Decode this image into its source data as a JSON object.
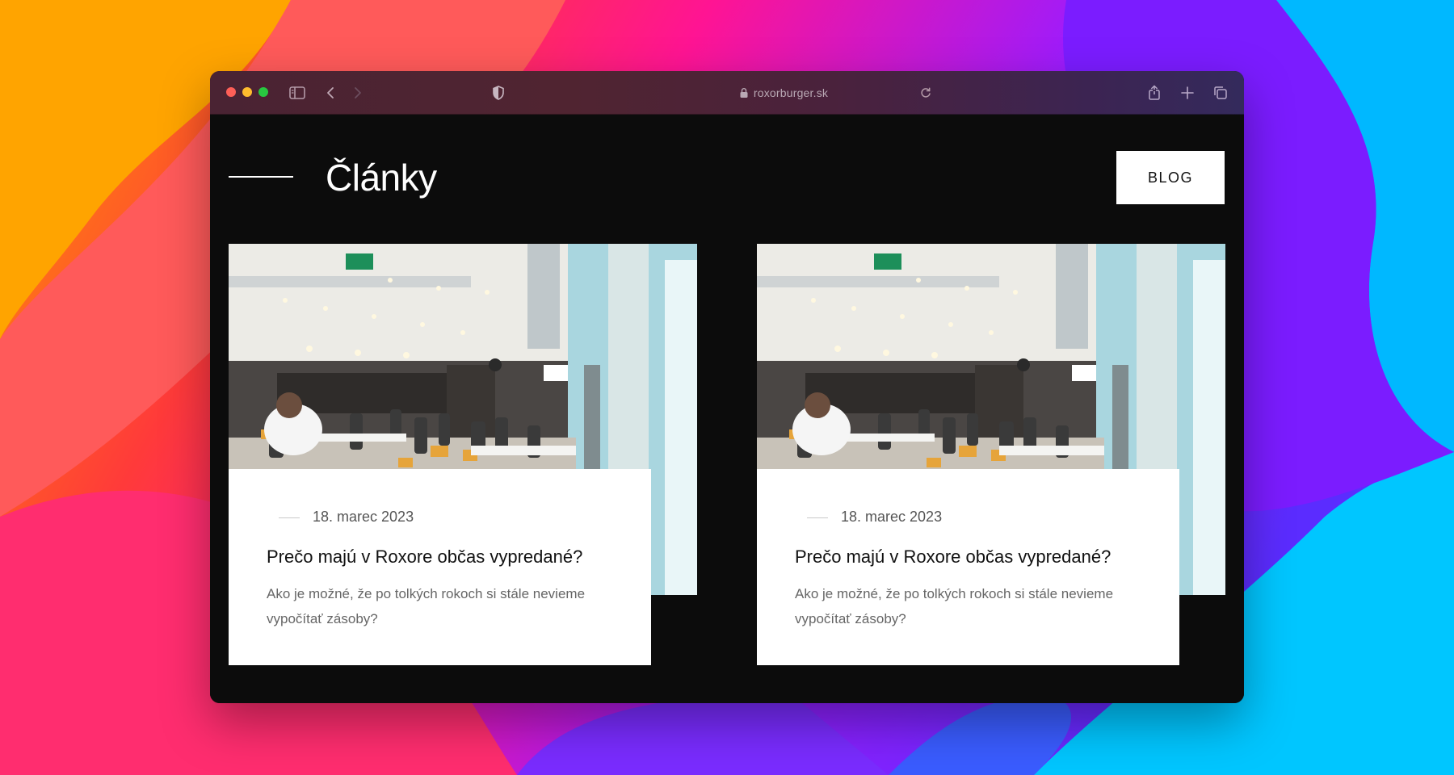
{
  "browser": {
    "url": "roxorburger.sk"
  },
  "page": {
    "title": "Články",
    "blog_button": "BLOG"
  },
  "articles": [
    {
      "date": "18. marec 2023",
      "title": "Prečo majú v Roxore občas vypredané?",
      "excerpt": "Ako je možné, že po tolkých rokoch si stále nevieme vypočítať zásoby?"
    },
    {
      "date": "18. marec 2023",
      "title": "Prečo majú v Roxore občas vypredané?",
      "excerpt": "Ako je možné, že po tolkých rokoch si stále nevieme vypočítať zásoby?"
    }
  ],
  "icons": {
    "sidebar": "sidebar-icon",
    "back": "chevron-left-icon",
    "forward": "chevron-right-icon",
    "privacy": "shield-icon",
    "lock": "lock-icon",
    "reload": "reload-icon",
    "share": "share-icon",
    "new_tab": "plus-icon",
    "tabs": "tabs-overview-icon"
  },
  "colors": {
    "page_background": "#0c0c0c",
    "card_background": "#ffffff",
    "button_background": "#ffffff",
    "traffic_red": "#fe5f57",
    "traffic_yellow": "#febc2e",
    "traffic_green": "#28c840"
  }
}
